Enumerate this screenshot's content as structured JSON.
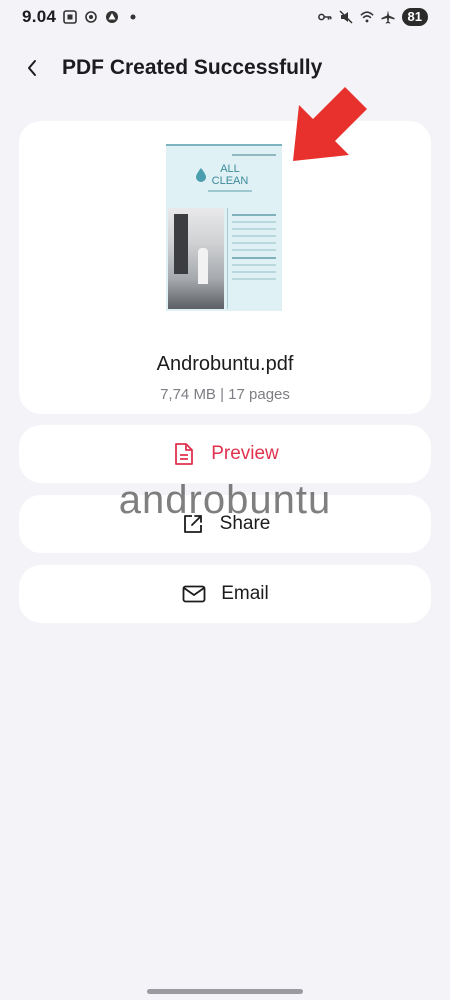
{
  "status_bar": {
    "time": "9.04",
    "battery": "81"
  },
  "header": {
    "title": "PDF Created Successfully"
  },
  "file": {
    "name": "Androbuntu.pdf",
    "meta": "7,74 MB | 17 pages",
    "thumbnail_logo_line1": "ALL",
    "thumbnail_logo_line2": "CLEAN"
  },
  "actions": {
    "preview_label": "Preview",
    "share_label": "Share",
    "email_label": "Email"
  },
  "watermark": "androbuntu",
  "colors": {
    "accent": "#e0324f",
    "arrow": "#e8312c",
    "background": "#f3f3f8",
    "card": "#ffffff"
  }
}
